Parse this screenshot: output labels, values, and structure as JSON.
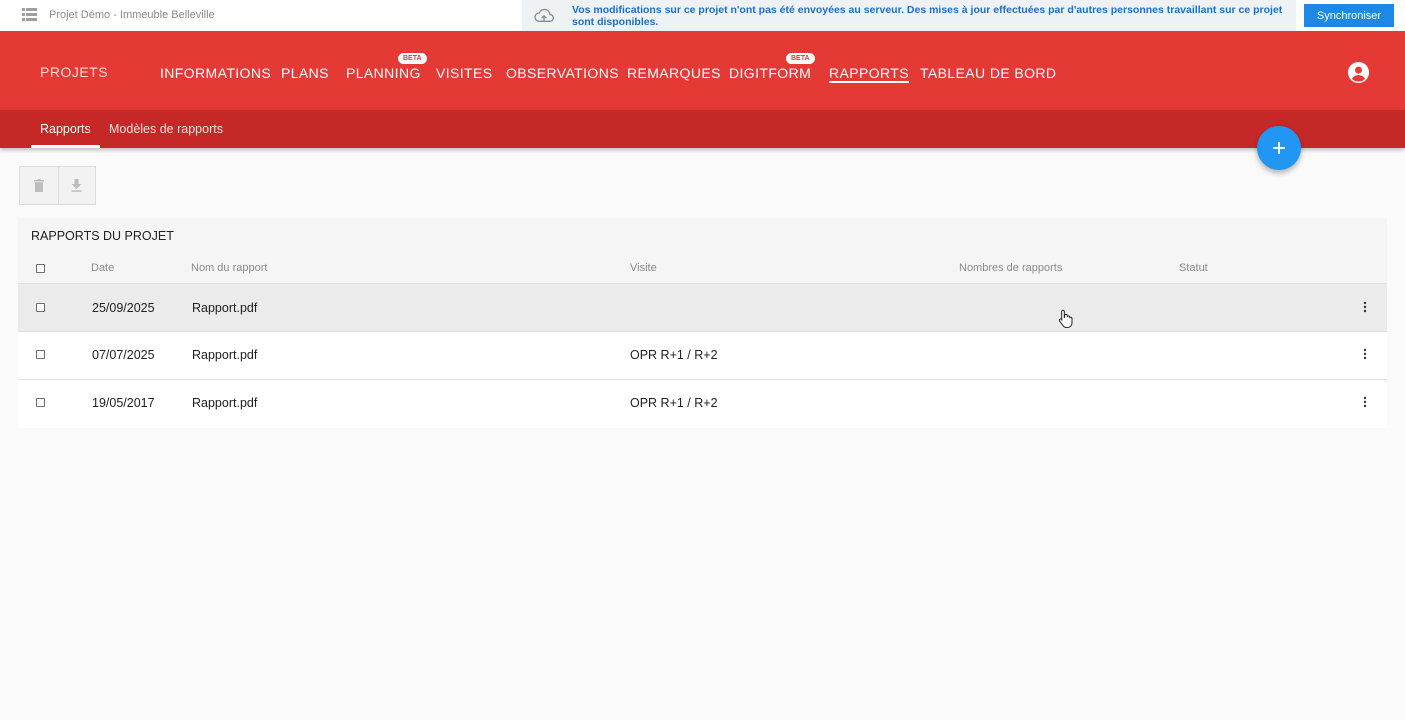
{
  "topbar": {
    "project_title": "Projet Démo - Immeuble Belleville",
    "sync_message": "Vos modifications sur ce projet n'ont pas été envoyées au serveur. Des mises à jour effectuées par d'autres personnes travaillant sur ce projet sont disponibles.",
    "sync_button": "Synchroniser"
  },
  "header": {
    "projects_link": "PROJETS",
    "nav": [
      {
        "label": "INFORMATIONS"
      },
      {
        "label": "PLANS"
      },
      {
        "label": "PLANNING",
        "badge": "BETA"
      },
      {
        "label": "VISITES"
      },
      {
        "label": "OBSERVATIONS"
      },
      {
        "label": "REMARQUES"
      },
      {
        "label": "DIGITFORM",
        "badge": "BETA"
      },
      {
        "label": "RAPPORTS",
        "active": true
      },
      {
        "label": "TABLEAU DE BORD"
      }
    ]
  },
  "subtabs": [
    {
      "label": "Rapports",
      "active": true
    },
    {
      "label": "Modèles de rapports"
    }
  ],
  "toolbar": {
    "delete_icon": "trash-icon",
    "download_icon": "download-icon"
  },
  "table": {
    "title": "RAPPORTS DU PROJET",
    "columns": [
      "Date",
      "Nom du rapport",
      "Visite",
      "Nombres de rapports",
      "Statut"
    ],
    "rows": [
      {
        "date": "25/09/2025",
        "name": "Rapport.pdf",
        "visit": "",
        "count": "",
        "status": ""
      },
      {
        "date": "07/07/2025",
        "name": "Rapport.pdf",
        "visit": "OPR R+1 / R+2",
        "count": "",
        "status": ""
      },
      {
        "date": "19/05/2017",
        "name": "Rapport.pdf",
        "visit": "OPR R+1 / R+2",
        "count": "",
        "status": ""
      }
    ]
  },
  "colors": {
    "header": "#e53935",
    "subbar": "#c62828",
    "accent": "#2196f3",
    "sync_text": "#1c6fc9"
  }
}
